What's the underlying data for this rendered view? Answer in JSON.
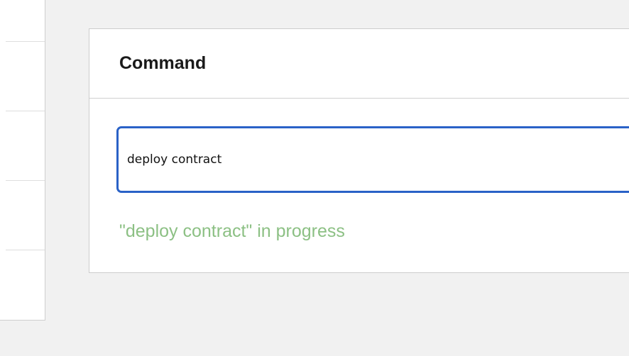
{
  "command_panel": {
    "title": "Command",
    "input_value": "deploy contract",
    "status": "\"deploy contract\" in progress"
  },
  "colors": {
    "background": "#f1f1f1",
    "input_focus_border": "#2a62c7",
    "status_text": "#8cc084"
  }
}
